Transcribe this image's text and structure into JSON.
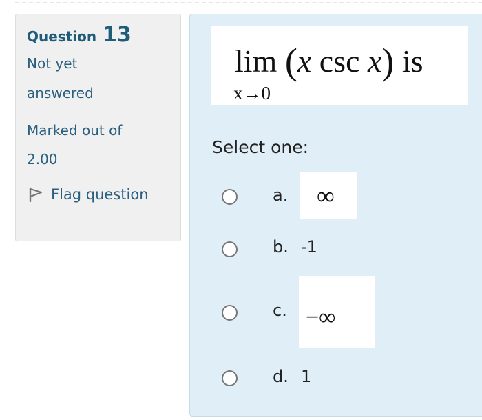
{
  "question": {
    "prefix": "Question",
    "number": "13",
    "state": [
      "Not yet",
      "answered"
    ],
    "grade": [
      "Marked out of",
      "2.00"
    ],
    "flag_label": "Flag question"
  },
  "qtext": {
    "expression": "lim (x csc x) is",
    "limit_subscript": "x→0"
  },
  "prompt": "Select one:",
  "options": [
    {
      "letter": "a.",
      "value": "∞"
    },
    {
      "letter": "b.",
      "value": "-1"
    },
    {
      "letter": "c.",
      "value": "−∞"
    },
    {
      "letter": "d.",
      "value": "1"
    }
  ],
  "colors": {
    "info_bg": "#f0f0f0",
    "content_bg": "#e0eef8",
    "heading": "#1f5c7a",
    "link": "#2b5f80"
  },
  "icons": {
    "flag": "flag-icon"
  }
}
